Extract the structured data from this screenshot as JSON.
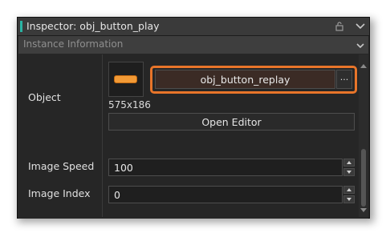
{
  "window": {
    "title": "Inspector: obj_button_play"
  },
  "section": {
    "title": "Instance Information"
  },
  "object": {
    "label": "Object",
    "value": "obj_button_replay",
    "menu_label": "···",
    "dimensions": "575x186",
    "open_editor_label": "Open Editor"
  },
  "image_speed": {
    "label": "Image Speed",
    "value": "100"
  },
  "image_index": {
    "label": "Image Index",
    "value": "0"
  },
  "icons": {
    "lock": "lock-icon",
    "window_menu": "chevron-down-icon",
    "section_toggle": "chevron-down-icon",
    "sprite_preview": "sprite-thumbnail"
  },
  "colors": {
    "accent": "#2ab3a3",
    "highlight": "#e8752a",
    "sprite": "#f29a36"
  }
}
